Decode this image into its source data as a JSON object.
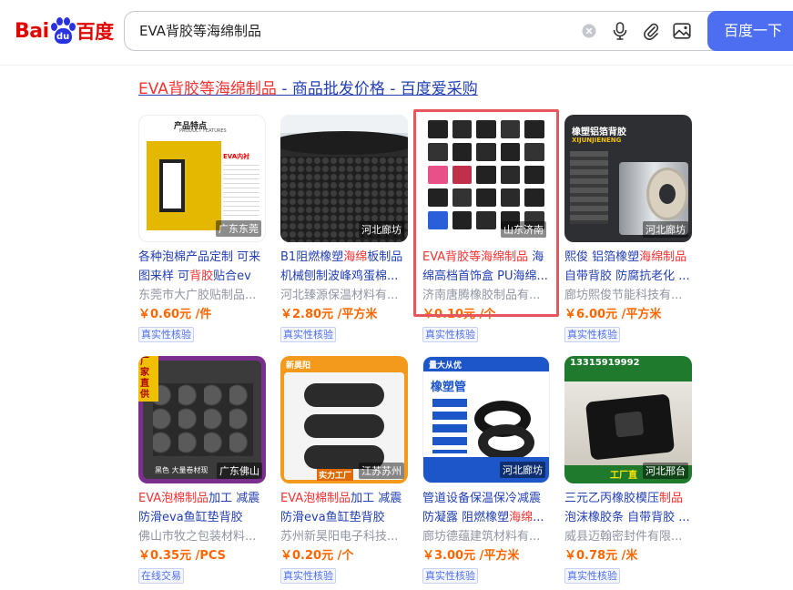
{
  "header": {
    "logo_left": "Bai",
    "logo_pad": "du",
    "logo_right": "百度",
    "search_value": "EVA背胶等海绵制品",
    "search_button": "百度一下",
    "icons": [
      "clear-icon",
      "microphone-icon",
      "attachment-icon",
      "image-search-icon"
    ]
  },
  "result": {
    "title_highlight": "EVA背胶等海绵制品",
    "title_rest": " - 商品批发价格 - 百度爱采购"
  },
  "products": [
    {
      "title_a": "各种泡棉产品定制 可来图来样 可",
      "title_hl": "背胶",
      "title_b": "贴合eva...",
      "seller": "东莞市大广胶贴制品...",
      "price": "￥0.60元 /件",
      "badge": "真实性核验",
      "location": "广东东莞",
      "image_text_top": "产品特点",
      "image_text_sub": "PRODUCT FEATURES",
      "image_text_tag": "EVA内衬"
    },
    {
      "title_a": "B1阻燃橡塑",
      "title_hl": "海绵",
      "title_b": "板制品机械刨制波峰鸡蛋棉...",
      "title_hl2": "制品",
      "seller": "河北臻源保温材料有...",
      "price": "￥2.80元 /平方米",
      "badge": "真实性核验",
      "location": "河北廊坊"
    },
    {
      "title_a": "",
      "title_hl": "EVA背胶等海绵制品",
      "title_b": " 海绵高档首饰盒 PU海绵...",
      "seller": "济南唐腾橡胶制品有...",
      "price": "￥0.10元 /个",
      "badge": "真实性核验",
      "location": "山东济南"
    },
    {
      "title_a": "熙俊 铝箔橡塑",
      "title_hl": "海绵制品",
      "title_b": " 自带背胶 防腐抗老化 ...",
      "seller": "廊坊熙俊节能科技有...",
      "price": "￥6.00元 /平方米",
      "badge": "真实性核验",
      "location": "河北廊坊",
      "image_text_top": "橡塑铝箔背胶",
      "image_text_sub": "XIJUNJIENENG"
    },
    {
      "title_a": "",
      "title_hl": "EVA泡棉制品",
      "title_b": "加工 减震防滑eva鱼缸垫背胶海...",
      "seller": "佛山市牧之包装材料...",
      "price": "￥0.35元 /PCS",
      "badge": "在线交易",
      "location": "广东佛山",
      "image_text_top": "厂家直供",
      "image_text_sub": "黑色 大量卷材现"
    },
    {
      "title_a": "",
      "title_hl": "EVA泡棉制品",
      "title_b": "加工 减震防滑eva鱼缸垫背胶海...",
      "seller": "苏州新昊阳电子科技...",
      "price": "￥0.20元 /个",
      "badge": "真实性核验",
      "location": "江苏苏州",
      "image_text_top": "新昊阳",
      "image_text_sub": "实力工厂"
    },
    {
      "title_a": "管道设备保温保冷减震防凝露 阻燃橡塑",
      "title_hl": "海绵",
      "title_b": "...",
      "seller": "廊坊德蕴建筑材料有...",
      "price": "￥3.00元 /平方米",
      "badge": "真实性核验",
      "location": "河北廊坊",
      "image_text_top": "量大从优",
      "image_text_sub": "橡塑管"
    },
    {
      "title_a": "三元乙丙橡胶模压",
      "title_hl": "制品",
      "title_b": "泡沫橡胶条 自带背胶 ...",
      "seller": "威县迈翰密封件有限...",
      "price": "￥0.78元 /米",
      "badge": "真实性核验",
      "location": "河北邢台",
      "image_text_top": "13315919992",
      "image_text_sub": "工厂直"
    }
  ],
  "colors": {
    "accent": "#4e6ef2",
    "highlight": "#f73131",
    "link": "#2440b3",
    "price": "#ff6600",
    "selection": "#e8555a"
  }
}
